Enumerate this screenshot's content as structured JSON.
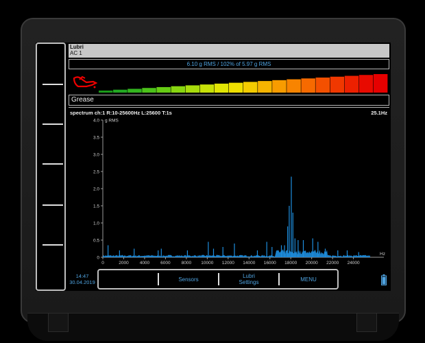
{
  "header": {
    "title": "Lubri",
    "channel": "AC 1"
  },
  "rms_readout": "6.10 g RMS / 102% of 5.97 g RMS",
  "level_bar": {
    "segments": 20,
    "active_level_percent": 100
  },
  "state_label": "Grease",
  "spectrum": {
    "title": "spectrum ch:1 R:10-25600Hz L:25600 T:1s",
    "peak_readout": "25.1Hz"
  },
  "chart_data": {
    "type": "line",
    "xlabel": "Hz",
    "ylabel": "g RMS",
    "xlim": [
      0,
      25600
    ],
    "ylim": [
      0,
      4.0
    ],
    "x_ticks": [
      0,
      2000,
      4000,
      6000,
      8000,
      10000,
      12000,
      14000,
      16000,
      18000,
      20000,
      22000,
      24000
    ],
    "y_ticks": [
      0,
      0.5,
      1.0,
      1.5,
      2.0,
      2.5,
      3.0,
      3.5,
      4.0
    ],
    "x_tick_labels": [
      "0",
      "2000",
      "4000",
      "6000",
      "8000",
      "10000",
      "12000",
      "14000",
      "16000",
      "18000",
      "20000",
      "22000",
      "24000"
    ],
    "y_tick_labels": [
      "0",
      "0.5",
      "1.0",
      "1.5",
      "2.0",
      "2.5",
      "3.0",
      "3.5",
      "4.0"
    ],
    "peaks": [
      {
        "x": 500,
        "y": 0.35
      },
      {
        "x": 1600,
        "y": 0.2
      },
      {
        "x": 3000,
        "y": 0.25
      },
      {
        "x": 5300,
        "y": 0.2
      },
      {
        "x": 5600,
        "y": 0.25
      },
      {
        "x": 8100,
        "y": 0.2
      },
      {
        "x": 10100,
        "y": 0.45
      },
      {
        "x": 10600,
        "y": 0.25
      },
      {
        "x": 11500,
        "y": 0.3
      },
      {
        "x": 12600,
        "y": 0.4
      },
      {
        "x": 14800,
        "y": 0.2
      },
      {
        "x": 15700,
        "y": 0.45
      },
      {
        "x": 16200,
        "y": 0.3
      },
      {
        "x": 17100,
        "y": 0.35
      },
      {
        "x": 17400,
        "y": 0.35
      },
      {
        "x": 17700,
        "y": 0.9
      },
      {
        "x": 17850,
        "y": 1.5
      },
      {
        "x": 18050,
        "y": 2.35
      },
      {
        "x": 18200,
        "y": 1.3
      },
      {
        "x": 18400,
        "y": 0.55
      },
      {
        "x": 18700,
        "y": 0.5
      },
      {
        "x": 19200,
        "y": 0.5
      },
      {
        "x": 20100,
        "y": 0.55
      },
      {
        "x": 20600,
        "y": 0.45
      },
      {
        "x": 21300,
        "y": 0.25
      },
      {
        "x": 22500,
        "y": 0.2
      },
      {
        "x": 23400,
        "y": 0.2
      },
      {
        "x": 24500,
        "y": 0.15
      }
    ]
  },
  "bottom_bar": {
    "time": "14:47",
    "date": "30.04.2019",
    "key1": "",
    "key2": "Sensors",
    "key3_line1": "Lubri",
    "key3_line2": "Settings",
    "key4": "MENU"
  },
  "colors": {
    "accent": "#4fa3e0",
    "spectrum": "#1e8fe0",
    "bar_low": "#e30000",
    "bar_high": "#ff0000"
  },
  "icons": {
    "oil_can": "oil-can-icon",
    "battery": "battery-icon"
  }
}
